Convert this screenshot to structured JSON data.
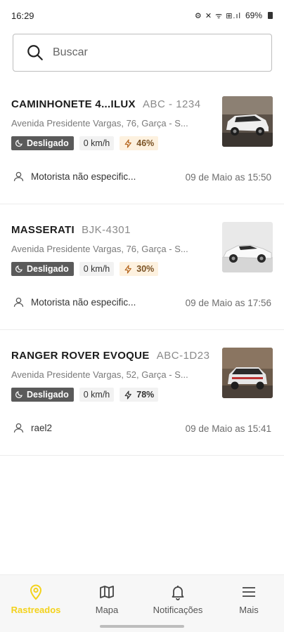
{
  "status_bar": {
    "time": "16:29",
    "icons": "⚙ ✕ ᯤ ⊞.ıl",
    "battery": "69%"
  },
  "search": {
    "placeholder": "Buscar"
  },
  "vehicles": [
    {
      "name": "CAMINHONETE 4...ILUX",
      "plate": "ABC - 1234",
      "address": "Avenida Presidente Vargas, 76, Garça - S...",
      "status": "Desligado",
      "speed": "0 km/h",
      "battery": "46%",
      "battery_level": 0.46,
      "driver": "Motorista não especific...",
      "time": "09 de Maio as 15:50",
      "thumb_icon": "white-suv-photo"
    },
    {
      "name": "MASSERATI",
      "plate": "BJK-4301",
      "address": "Avenida Presidente Vargas, 76, Garça - S...",
      "status": "Desligado",
      "speed": "0 km/h",
      "battery": "30%",
      "battery_level": 0.3,
      "driver": "Motorista não especific...",
      "time": "09 de Maio as 17:56",
      "thumb_icon": "white-sports-car-photo"
    },
    {
      "name": "RANGER ROVER EVOQUE",
      "plate": "ABC-1D23",
      "address": "Avenida Presidente Vargas, 52, Garça - S...",
      "status": "Desligado",
      "speed": "0 km/h",
      "battery": "78%",
      "battery_level": 0.78,
      "driver": "rael2",
      "time": "09 de Maio as 15:41",
      "thumb_icon": "white-suv-rear-photo"
    }
  ],
  "bottom_nav": {
    "items": [
      {
        "label": "Rastreados",
        "icon": "map-pin-icon",
        "active": true
      },
      {
        "label": "Mapa",
        "icon": "map-icon",
        "active": false
      },
      {
        "label": "Notificações",
        "icon": "bell-icon",
        "active": false
      },
      {
        "label": "Mais",
        "icon": "menu-icon",
        "active": false
      }
    ]
  },
  "colors": {
    "accent": "#f3d21b",
    "status_chip": "#5a5a5a",
    "battery_warn_bg": "#fdf1df"
  }
}
